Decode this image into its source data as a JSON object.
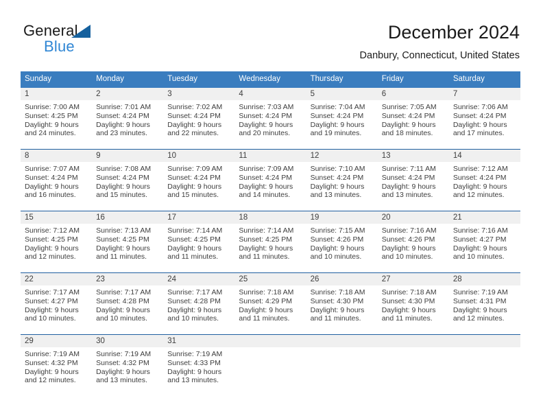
{
  "logo": {
    "word_one": "General",
    "word_two": "Blue",
    "triangle_color": "#16619e",
    "blue_color": "#2f86d4"
  },
  "header": {
    "month_title": "December 2024",
    "location": "Danbury, Connecticut, United States"
  },
  "theme": {
    "header_blue": "#3a7dbf",
    "separator_blue": "#1f5fa0",
    "band_gray": "#f0f0f0"
  },
  "weekday_headers": [
    "Sunday",
    "Monday",
    "Tuesday",
    "Wednesday",
    "Thursday",
    "Friday",
    "Saturday"
  ],
  "weeks": [
    [
      {
        "day": "1",
        "lines": [
          "Sunrise: 7:00 AM",
          "Sunset: 4:25 PM",
          "Daylight: 9 hours",
          "and 24 minutes."
        ]
      },
      {
        "day": "2",
        "lines": [
          "Sunrise: 7:01 AM",
          "Sunset: 4:24 PM",
          "Daylight: 9 hours",
          "and 23 minutes."
        ]
      },
      {
        "day": "3",
        "lines": [
          "Sunrise: 7:02 AM",
          "Sunset: 4:24 PM",
          "Daylight: 9 hours",
          "and 22 minutes."
        ]
      },
      {
        "day": "4",
        "lines": [
          "Sunrise: 7:03 AM",
          "Sunset: 4:24 PM",
          "Daylight: 9 hours",
          "and 20 minutes."
        ]
      },
      {
        "day": "5",
        "lines": [
          "Sunrise: 7:04 AM",
          "Sunset: 4:24 PM",
          "Daylight: 9 hours",
          "and 19 minutes."
        ]
      },
      {
        "day": "6",
        "lines": [
          "Sunrise: 7:05 AM",
          "Sunset: 4:24 PM",
          "Daylight: 9 hours",
          "and 18 minutes."
        ]
      },
      {
        "day": "7",
        "lines": [
          "Sunrise: 7:06 AM",
          "Sunset: 4:24 PM",
          "Daylight: 9 hours",
          "and 17 minutes."
        ]
      }
    ],
    [
      {
        "day": "8",
        "lines": [
          "Sunrise: 7:07 AM",
          "Sunset: 4:24 PM",
          "Daylight: 9 hours",
          "and 16 minutes."
        ]
      },
      {
        "day": "9",
        "lines": [
          "Sunrise: 7:08 AM",
          "Sunset: 4:24 PM",
          "Daylight: 9 hours",
          "and 15 minutes."
        ]
      },
      {
        "day": "10",
        "lines": [
          "Sunrise: 7:09 AM",
          "Sunset: 4:24 PM",
          "Daylight: 9 hours",
          "and 15 minutes."
        ]
      },
      {
        "day": "11",
        "lines": [
          "Sunrise: 7:09 AM",
          "Sunset: 4:24 PM",
          "Daylight: 9 hours",
          "and 14 minutes."
        ]
      },
      {
        "day": "12",
        "lines": [
          "Sunrise: 7:10 AM",
          "Sunset: 4:24 PM",
          "Daylight: 9 hours",
          "and 13 minutes."
        ]
      },
      {
        "day": "13",
        "lines": [
          "Sunrise: 7:11 AM",
          "Sunset: 4:24 PM",
          "Daylight: 9 hours",
          "and 13 minutes."
        ]
      },
      {
        "day": "14",
        "lines": [
          "Sunrise: 7:12 AM",
          "Sunset: 4:24 PM",
          "Daylight: 9 hours",
          "and 12 minutes."
        ]
      }
    ],
    [
      {
        "day": "15",
        "lines": [
          "Sunrise: 7:12 AM",
          "Sunset: 4:25 PM",
          "Daylight: 9 hours",
          "and 12 minutes."
        ]
      },
      {
        "day": "16",
        "lines": [
          "Sunrise: 7:13 AM",
          "Sunset: 4:25 PM",
          "Daylight: 9 hours",
          "and 11 minutes."
        ]
      },
      {
        "day": "17",
        "lines": [
          "Sunrise: 7:14 AM",
          "Sunset: 4:25 PM",
          "Daylight: 9 hours",
          "and 11 minutes."
        ]
      },
      {
        "day": "18",
        "lines": [
          "Sunrise: 7:14 AM",
          "Sunset: 4:25 PM",
          "Daylight: 9 hours",
          "and 11 minutes."
        ]
      },
      {
        "day": "19",
        "lines": [
          "Sunrise: 7:15 AM",
          "Sunset: 4:26 PM",
          "Daylight: 9 hours",
          "and 10 minutes."
        ]
      },
      {
        "day": "20",
        "lines": [
          "Sunrise: 7:16 AM",
          "Sunset: 4:26 PM",
          "Daylight: 9 hours",
          "and 10 minutes."
        ]
      },
      {
        "day": "21",
        "lines": [
          "Sunrise: 7:16 AM",
          "Sunset: 4:27 PM",
          "Daylight: 9 hours",
          "and 10 minutes."
        ]
      }
    ],
    [
      {
        "day": "22",
        "lines": [
          "Sunrise: 7:17 AM",
          "Sunset: 4:27 PM",
          "Daylight: 9 hours",
          "and 10 minutes."
        ]
      },
      {
        "day": "23",
        "lines": [
          "Sunrise: 7:17 AM",
          "Sunset: 4:28 PM",
          "Daylight: 9 hours",
          "and 10 minutes."
        ]
      },
      {
        "day": "24",
        "lines": [
          "Sunrise: 7:17 AM",
          "Sunset: 4:28 PM",
          "Daylight: 9 hours",
          "and 10 minutes."
        ]
      },
      {
        "day": "25",
        "lines": [
          "Sunrise: 7:18 AM",
          "Sunset: 4:29 PM",
          "Daylight: 9 hours",
          "and 11 minutes."
        ]
      },
      {
        "day": "26",
        "lines": [
          "Sunrise: 7:18 AM",
          "Sunset: 4:30 PM",
          "Daylight: 9 hours",
          "and 11 minutes."
        ]
      },
      {
        "day": "27",
        "lines": [
          "Sunrise: 7:18 AM",
          "Sunset: 4:30 PM",
          "Daylight: 9 hours",
          "and 11 minutes."
        ]
      },
      {
        "day": "28",
        "lines": [
          "Sunrise: 7:19 AM",
          "Sunset: 4:31 PM",
          "Daylight: 9 hours",
          "and 12 minutes."
        ]
      }
    ],
    [
      {
        "day": "29",
        "lines": [
          "Sunrise: 7:19 AM",
          "Sunset: 4:32 PM",
          "Daylight: 9 hours",
          "and 12 minutes."
        ]
      },
      {
        "day": "30",
        "lines": [
          "Sunrise: 7:19 AM",
          "Sunset: 4:32 PM",
          "Daylight: 9 hours",
          "and 13 minutes."
        ]
      },
      {
        "day": "31",
        "lines": [
          "Sunrise: 7:19 AM",
          "Sunset: 4:33 PM",
          "Daylight: 9 hours",
          "and 13 minutes."
        ]
      },
      {
        "day": "",
        "lines": []
      },
      {
        "day": "",
        "lines": []
      },
      {
        "day": "",
        "lines": []
      },
      {
        "day": "",
        "lines": []
      }
    ]
  ]
}
